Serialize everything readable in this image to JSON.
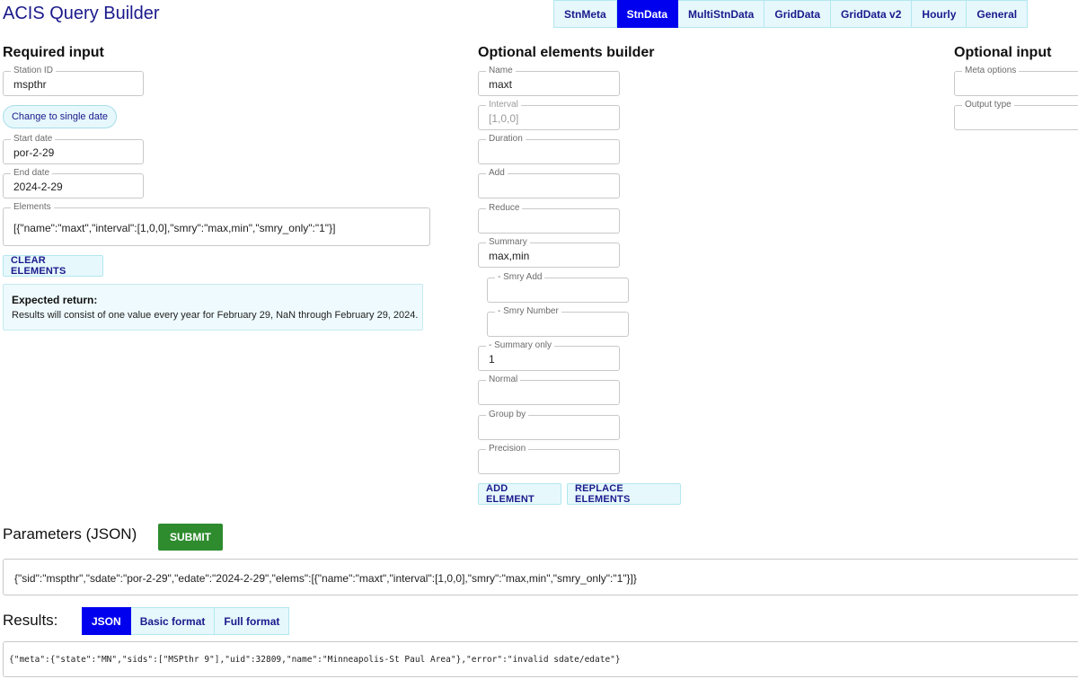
{
  "app": {
    "title": "ACIS Query Builder"
  },
  "tabs": [
    "StnMeta",
    "StnData",
    "MultiStnData",
    "GridData",
    "GridData v2",
    "Hourly",
    "General"
  ],
  "active_tab": "StnData",
  "required": {
    "title": "Required input",
    "station_id": {
      "label": "Station ID",
      "value": "mspthr"
    },
    "toggle_button": "Change to single date",
    "start_date": {
      "label": "Start date",
      "value": "por-2-29"
    },
    "end_date": {
      "label": "End date",
      "value": "2024-2-29"
    },
    "elements": {
      "label": "Elements",
      "value": "[{\"name\":\"maxt\",\"interval\":[1,0,0],\"smry\":\"max,min\",\"smry_only\":\"1\"}]"
    },
    "clear_button": "CLEAR ELEMENTS",
    "expected": {
      "heading": "Expected return:",
      "text": "Results will consist of one value every year for February 29, NaN through February 29, 2024."
    }
  },
  "builder": {
    "title": "Optional elements builder",
    "name": {
      "label": "Name",
      "value": "maxt"
    },
    "interval": {
      "label": "Interval",
      "value": "[1,0,0]"
    },
    "duration": {
      "label": "Duration",
      "value": ""
    },
    "add": {
      "label": "Add",
      "value": ""
    },
    "reduce": {
      "label": "Reduce",
      "value": ""
    },
    "summary": {
      "label": "Summary",
      "value": "max,min"
    },
    "smry_add": {
      "label": "- Smry Add",
      "value": ""
    },
    "smry_number": {
      "label": "- Smry Number",
      "value": ""
    },
    "summary_only": {
      "label": "- Summary only",
      "value": "1"
    },
    "normal": {
      "label": "Normal",
      "value": ""
    },
    "group_by": {
      "label": "Group by",
      "value": ""
    },
    "precision": {
      "label": "Precision",
      "value": ""
    },
    "add_button": "ADD ELEMENT",
    "replace_button": "REPLACE ELEMENTS"
  },
  "optional": {
    "title": "Optional input",
    "meta_options": {
      "label": "Meta options",
      "value": ""
    },
    "output_type": {
      "label": "Output type",
      "value": ""
    }
  },
  "params": {
    "title": "Parameters (JSON)",
    "submit": "SUBMIT",
    "value": "{\"sid\":\"mspthr\",\"sdate\":\"por-2-29\",\"edate\":\"2024-2-29\",\"elems\":[{\"name\":\"maxt\",\"interval\":[1,0,0],\"smry\":\"max,min\",\"smry_only\":\"1\"}]}"
  },
  "results": {
    "title": "Results:",
    "tabs": [
      "JSON",
      "Basic format",
      "Full format"
    ],
    "active_tab": "JSON",
    "value": "{\"meta\":{\"state\":\"MN\",\"sids\":[\"MSPthr 9\"],\"uid\":32809,\"name\":\"Minneapolis-St Paul Area\"},\"error\":\"invalid sdate/edate\"}"
  },
  "colors": {
    "accent": "#0000ee",
    "tab_bg": "#e6f8fc",
    "submit": "#2e8b2e",
    "title": "#1a1a8c"
  }
}
